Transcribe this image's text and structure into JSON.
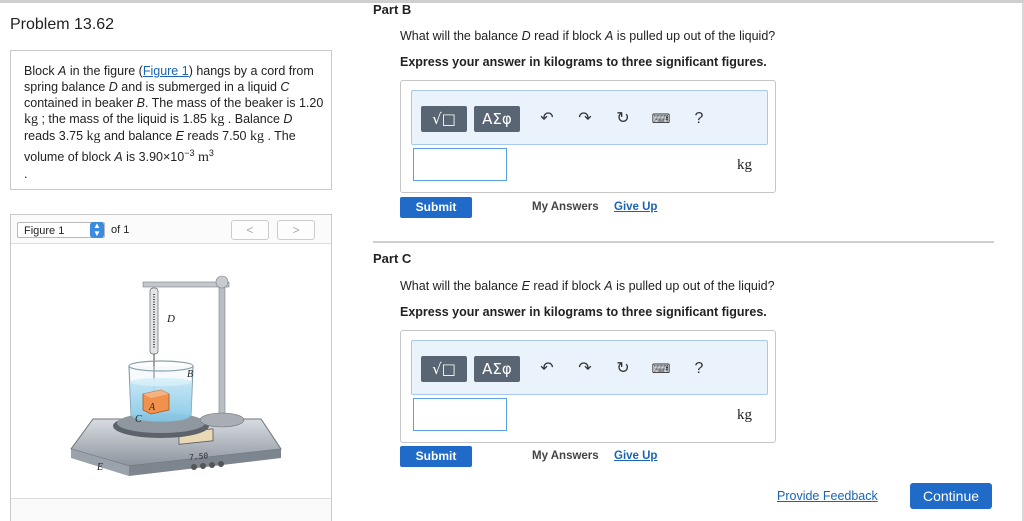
{
  "problem": {
    "title": "Problem 13.62",
    "text": {
      "t1": "Block ",
      "var_a": "A",
      "t2": " in the figure (",
      "fig_link": "Figure 1",
      "t3": ") hangs by a cord from spring balance ",
      "var_d": "D",
      "t4": " and is submerged in a liquid ",
      "var_c": "C",
      "t5": " contained in beaker ",
      "var_b": "B",
      "t6": ". The mass of the beaker is 1.20 ",
      "unit_kg": "kg",
      "t7": " ; the mass of the liquid is 1.85 ",
      "t8": " . Balance ",
      "t9": " reads 3.75 ",
      "t10": " and balance ",
      "var_e": "E",
      "t11": " reads 7.50 ",
      "t12": " . The volume of block ",
      "t13": " is 3.90×10",
      "exp_neg3": "−3",
      "unit_m": "m",
      "exp_3": "3",
      "t14": "."
    }
  },
  "figure": {
    "select_value": "Figure 1",
    "of_label": "of 1",
    "prev": "<",
    "next": ">",
    "labels": {
      "d": "D",
      "b": "B",
      "c": "C",
      "a": "A",
      "e": "E",
      "display": "7.50"
    }
  },
  "partB": {
    "title": "Part B",
    "q1": "What will the balance ",
    "q_var": "D",
    "q2": " read if block ",
    "q_var2": "A",
    "q3": " is pulled up out of the liquid?",
    "express": "Express your answer in kilograms to three significant figures.",
    "unit": "kg",
    "input_value": ""
  },
  "partC": {
    "title": "Part C",
    "q1": "What will the balance ",
    "q_var": "E",
    "q2": " read if block ",
    "q_var2": "A",
    "q3": " is pulled up out of the liquid?",
    "express": "Express your answer in kilograms to three significant figures.",
    "unit": "kg",
    "input_value": ""
  },
  "toolbar": {
    "templates_label": "√□",
    "greek_label": "ΑΣφ",
    "undo_icon": "undo-icon",
    "redo_icon": "redo-icon",
    "reset_icon": "reset-icon",
    "keyboard_icon": "keyboard-icon",
    "help_label": "?"
  },
  "actions": {
    "submit": "Submit",
    "my_answers": "My Answers",
    "give_up": "Give Up",
    "feedback": "Provide Feedback",
    "continue": "Continue"
  }
}
